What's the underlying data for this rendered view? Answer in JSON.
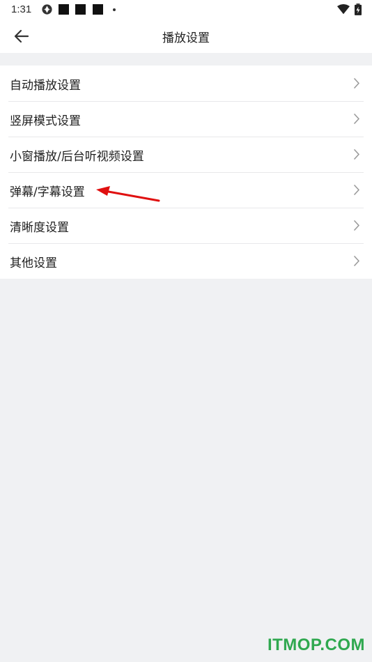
{
  "status_bar": {
    "time": "1:31",
    "icons": [
      "aperture-icon",
      "notification-square-icon",
      "notification-square-icon",
      "notification-square-icon",
      "more-dot-icon",
      "wifi-icon",
      "battery-charging-icon"
    ]
  },
  "header": {
    "title": "播放设置",
    "back_icon": "arrow-left-icon"
  },
  "settings": {
    "items": [
      {
        "label": "自动播放设置"
      },
      {
        "label": "竖屏模式设置"
      },
      {
        "label": "小窗播放/后台听视频设置"
      },
      {
        "label": "弹幕/字幕设置"
      },
      {
        "label": "清晰度设置"
      },
      {
        "label": "其他设置"
      }
    ],
    "chevron_icon": "chevron-right-icon"
  },
  "annotation": {
    "type": "arrow",
    "color": "#e01010",
    "target_item_index": 3
  },
  "watermark": {
    "text": "ITMOP.COM",
    "color": "#2fa84f"
  },
  "colors": {
    "background": "#f0f1f3",
    "surface": "#ffffff",
    "text": "#1f1f1f",
    "chevron": "#9a9a9a"
  }
}
